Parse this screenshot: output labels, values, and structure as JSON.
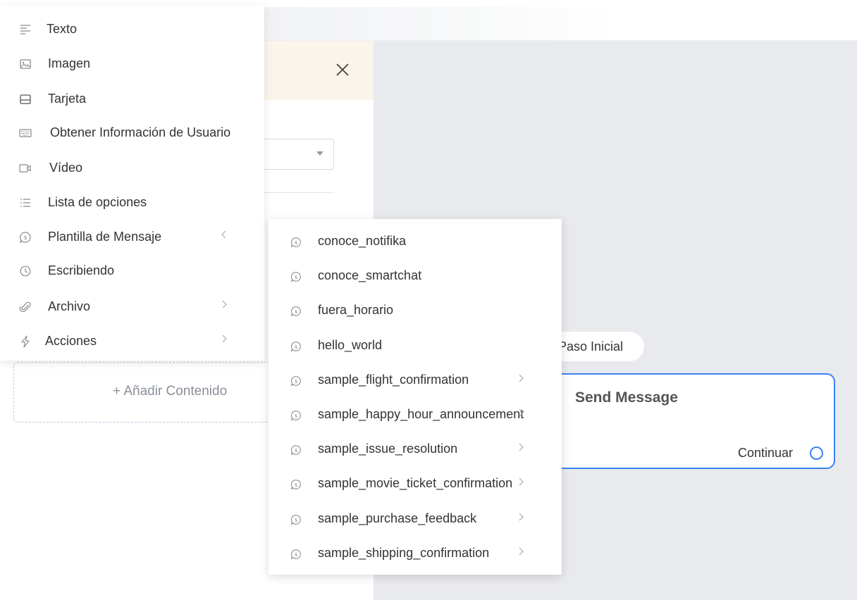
{
  "menu": {
    "items": [
      {
        "label": "Texto",
        "icon": "text-icon",
        "name": "menu-item-texto",
        "has_submenu": false
      },
      {
        "label": "Imagen",
        "icon": "image-icon",
        "name": "menu-item-imagen",
        "has_submenu": false
      },
      {
        "label": "Tarjeta",
        "icon": "card-icon",
        "name": "menu-item-tarjeta",
        "has_submenu": false
      },
      {
        "label": "Obtener Información de Usuario",
        "icon": "keyboard-icon",
        "name": "menu-item-obtener-informacion",
        "has_submenu": false
      },
      {
        "label": "Vídeo",
        "icon": "video-icon",
        "name": "menu-item-video",
        "has_submenu": false
      },
      {
        "label": "Lista de opciones",
        "icon": "list-icon",
        "name": "menu-item-lista-opciones",
        "has_submenu": false
      },
      {
        "label": "Plantilla de Mensaje",
        "icon": "message-template-icon",
        "name": "menu-item-plantilla-mensaje",
        "has_submenu": true,
        "expanded": true
      },
      {
        "label": "Escribiendo",
        "icon": "clock-icon",
        "name": "menu-item-escribiendo",
        "has_submenu": false
      },
      {
        "label": "Archivo",
        "icon": "paperclip-icon",
        "name": "menu-item-archivo",
        "has_submenu": true
      },
      {
        "label": "Acciones",
        "icon": "lightning-icon",
        "name": "menu-item-acciones",
        "has_submenu": true
      }
    ]
  },
  "submenu": {
    "items": [
      {
        "label": "conoce_notifika",
        "has_submenu": false
      },
      {
        "label": "conoce_smartchat",
        "has_submenu": false
      },
      {
        "label": "fuera_horario",
        "has_submenu": false
      },
      {
        "label": "hello_world",
        "has_submenu": false
      },
      {
        "label": "sample_flight_confirmation",
        "has_submenu": true
      },
      {
        "label": "sample_happy_hour_announcement",
        "has_submenu": true
      },
      {
        "label": "sample_issue_resolution",
        "has_submenu": true
      },
      {
        "label": "sample_movie_ticket_confirmation",
        "has_submenu": true
      },
      {
        "label": "sample_purchase_feedback",
        "has_submenu": true
      },
      {
        "label": "sample_shipping_confirmation",
        "has_submenu": true
      }
    ]
  },
  "content": {
    "add_content_label": "+ Añadir Contenido"
  },
  "flow": {
    "step_label": "Paso Inicial",
    "node_title": "Send Message",
    "node_continue": "Continuar"
  },
  "colors": {
    "accent": "#3b82f6",
    "canvas_bg": "#e9eaee",
    "panel_header_bg": "#fbf4eb"
  }
}
